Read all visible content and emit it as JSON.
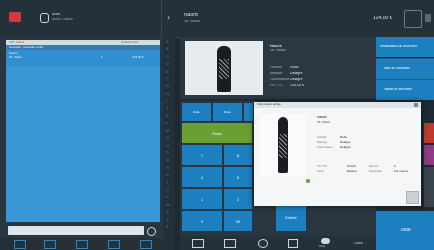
{
  "topbar": {
    "status_title": "Arrêt",
    "status_sub": "Mode Caisse",
    "line_number": "1",
    "product_name": "Naomi",
    "product_variant": "36 / Black",
    "price": "124,00 €"
  },
  "cart": {
    "header_left": "LIB / Article",
    "header_right": "Quantité Prix",
    "sub_header": "Nouvelle - Nouvelle vente",
    "item_name": "Naomi",
    "item_detail": "36 / Black",
    "item_qty": "1",
    "item_price": "124,00 €"
  },
  "product_panel": {
    "name": "Naomi",
    "variant": "36 / Black",
    "fields": [
      {
        "label": "Famille",
        "value": "Robe"
      },
      {
        "label": "Marque",
        "value": "Delagre"
      },
      {
        "label": "Fournisseur",
        "value": "Delagre"
      },
      {
        "label": "PU TTC",
        "value": "124,00 €"
      }
    ]
  },
  "right_actions": [
    "Réclamation de document",
    "Mise en document",
    "Valider le document"
  ],
  "quick_grid": [
    "Robe",
    "Robe",
    "Robe",
    "Robe"
  ],
  "green_button": "Robe",
  "enter_button": "Entrée",
  "total_label": "Total",
  "bottom_label_2": "Client",
  "bottom_label_1": "Infos",
  "dialog": {
    "title": "Information article",
    "name": "Naomi",
    "variant": "36 / Black",
    "fields": [
      {
        "label": "Famille",
        "value": "Robe"
      },
      {
        "label": "Marque",
        "value": "Delagre"
      },
      {
        "label": "Fournisseur",
        "value": "Delagre"
      }
    ],
    "stock_rows": [
      {
        "label": "PU TTC",
        "a": "124,00",
        "b": "Remise",
        "c": "0"
      },
      {
        "label": "Stock",
        "a": "Réserve",
        "b": "Disponible",
        "c": "Sur mesure"
      }
    ]
  },
  "alpha": [
    "A",
    "B",
    "C",
    "D",
    "E",
    "F",
    "G",
    "H",
    "I",
    "J",
    "K",
    "L",
    "M",
    "N",
    "O",
    "P",
    "Q",
    "R",
    "S",
    "T",
    "U",
    "V",
    "W",
    "X",
    "Y",
    "Z"
  ],
  "colors": {
    "accent": "#1c7fc0",
    "green": "#6aa033",
    "red": "#c0392b",
    "purple": "#8e3c86"
  }
}
